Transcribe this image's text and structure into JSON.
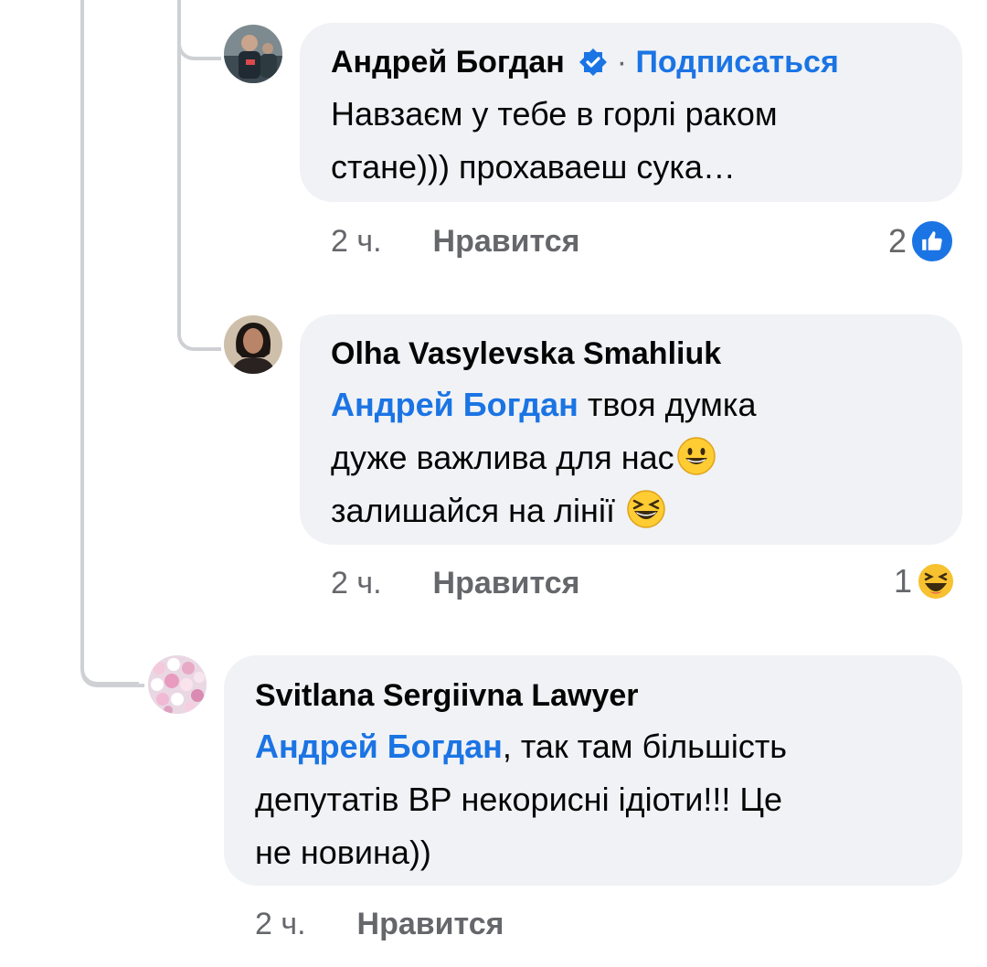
{
  "comments": [
    {
      "author": "Андрей Богдан",
      "verified": true,
      "separator": "·",
      "follow_label": "Подписаться",
      "lines": [
        "Навзаєм у тебе в горлі раком",
        "стане))) прохаваеш сука…"
      ],
      "time": "2 ч.",
      "like_label": "Нравится",
      "reaction_count": "2",
      "reaction_icon": "like-icon",
      "avatar_icon": "person-photo-icon"
    },
    {
      "author": "Olha Vasylevska Smahliuk",
      "mention": "Андрей Богдан",
      "line1_text": " твоя думка",
      "line2_text": "дуже важлива для нас",
      "line3_text": "залишайся на лінії ",
      "time": "2 ч.",
      "like_label": "Нравится",
      "reaction_count": "1",
      "reaction_icon": "haha-icon",
      "avatar_icon": "person-photo-icon"
    },
    {
      "author": "Svitlana Sergiivna Lawyer",
      "mention": "Андрей Богдан",
      "line1_text": ", так там більшість",
      "line2_text": "депутатів ВР некорисні ідіоти!!! Це",
      "line3_text": "не новина))",
      "time": "2 ч.",
      "like_label": "Нравится",
      "avatar_icon": "flowers-photo-icon"
    }
  ],
  "colors": {
    "bubble": "#f0f2f5",
    "link": "#1b74e4",
    "meta": "#65676b",
    "line": "#ced0d4"
  }
}
